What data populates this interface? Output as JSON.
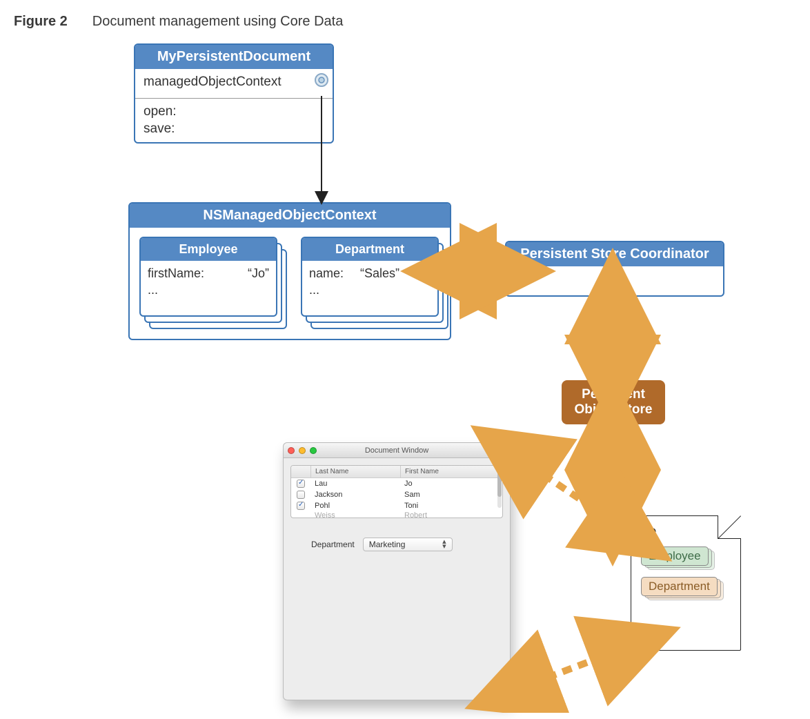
{
  "figure": {
    "label": "Figure 2",
    "title": "Document management using Core Data"
  },
  "persistentDoc": {
    "title": "MyPersistentDocument",
    "attr": "managedObjectContext",
    "methods": [
      "open:",
      "save:"
    ]
  },
  "context": {
    "title": "NSManagedObjectContext",
    "employee": {
      "title": "Employee",
      "key": "firstName:",
      "value": "“Jo”",
      "more": "..."
    },
    "department": {
      "title": "Department",
      "key": "name:",
      "value": "“Sales”",
      "more": "..."
    }
  },
  "coordinator": {
    "title": "Persistent Store Coordinator",
    "body": "..."
  },
  "objectStore": {
    "line1": "Persistent",
    "line2": "Object Store"
  },
  "window": {
    "title": "Document Window",
    "columns": {
      "check": "",
      "last": "Last Name",
      "first": "First Name"
    },
    "rows": [
      {
        "checked": true,
        "last": "Lau",
        "first": "Jo"
      },
      {
        "checked": false,
        "last": "Jackson",
        "first": "Sam"
      },
      {
        "checked": true,
        "last": "Pohl",
        "first": "Toni"
      }
    ],
    "cutoffRow": {
      "last": "Weiss",
      "first": "Robert"
    },
    "deptLabel": "Department",
    "deptValue": "Marketing"
  },
  "file": {
    "label": "file",
    "employee": "Employee",
    "department": "Department"
  }
}
